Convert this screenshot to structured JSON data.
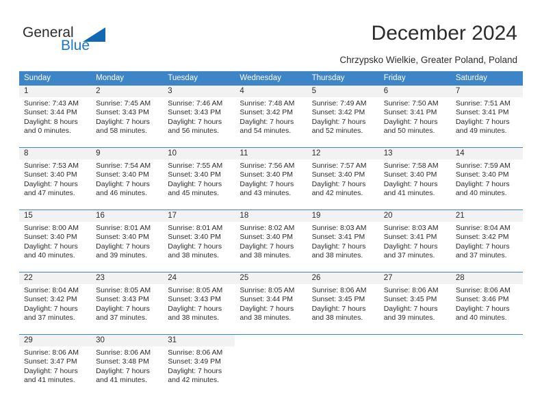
{
  "brand": {
    "word1": "General",
    "word2": "Blue",
    "logo_icon": "triangle-logo-icon",
    "blue": "#1878c8",
    "triangle_color": "#1268b3"
  },
  "header": {
    "month_title": "December 2024",
    "location": "Chrzypsko Wielkie, Greater Poland, Poland"
  },
  "calendar": {
    "header_bg": "#3d85c6",
    "day_num_bg": "#f2f2f2",
    "weekdays": [
      "Sunday",
      "Monday",
      "Tuesday",
      "Wednesday",
      "Thursday",
      "Friday",
      "Saturday"
    ],
    "weeks": [
      [
        {
          "day": "1",
          "sunrise": "Sunrise: 7:43 AM",
          "sunset": "Sunset: 3:44 PM",
          "daylight1": "Daylight: 8 hours",
          "daylight2": "and 0 minutes."
        },
        {
          "day": "2",
          "sunrise": "Sunrise: 7:45 AM",
          "sunset": "Sunset: 3:43 PM",
          "daylight1": "Daylight: 7 hours",
          "daylight2": "and 58 minutes."
        },
        {
          "day": "3",
          "sunrise": "Sunrise: 7:46 AM",
          "sunset": "Sunset: 3:43 PM",
          "daylight1": "Daylight: 7 hours",
          "daylight2": "and 56 minutes."
        },
        {
          "day": "4",
          "sunrise": "Sunrise: 7:48 AM",
          "sunset": "Sunset: 3:42 PM",
          "daylight1": "Daylight: 7 hours",
          "daylight2": "and 54 minutes."
        },
        {
          "day": "5",
          "sunrise": "Sunrise: 7:49 AM",
          "sunset": "Sunset: 3:42 PM",
          "daylight1": "Daylight: 7 hours",
          "daylight2": "and 52 minutes."
        },
        {
          "day": "6",
          "sunrise": "Sunrise: 7:50 AM",
          "sunset": "Sunset: 3:41 PM",
          "daylight1": "Daylight: 7 hours",
          "daylight2": "and 50 minutes."
        },
        {
          "day": "7",
          "sunrise": "Sunrise: 7:51 AM",
          "sunset": "Sunset: 3:41 PM",
          "daylight1": "Daylight: 7 hours",
          "daylight2": "and 49 minutes."
        }
      ],
      [
        {
          "day": "8",
          "sunrise": "Sunrise: 7:53 AM",
          "sunset": "Sunset: 3:40 PM",
          "daylight1": "Daylight: 7 hours",
          "daylight2": "and 47 minutes."
        },
        {
          "day": "9",
          "sunrise": "Sunrise: 7:54 AM",
          "sunset": "Sunset: 3:40 PM",
          "daylight1": "Daylight: 7 hours",
          "daylight2": "and 46 minutes."
        },
        {
          "day": "10",
          "sunrise": "Sunrise: 7:55 AM",
          "sunset": "Sunset: 3:40 PM",
          "daylight1": "Daylight: 7 hours",
          "daylight2": "and 45 minutes."
        },
        {
          "day": "11",
          "sunrise": "Sunrise: 7:56 AM",
          "sunset": "Sunset: 3:40 PM",
          "daylight1": "Daylight: 7 hours",
          "daylight2": "and 43 minutes."
        },
        {
          "day": "12",
          "sunrise": "Sunrise: 7:57 AM",
          "sunset": "Sunset: 3:40 PM",
          "daylight1": "Daylight: 7 hours",
          "daylight2": "and 42 minutes."
        },
        {
          "day": "13",
          "sunrise": "Sunrise: 7:58 AM",
          "sunset": "Sunset: 3:40 PM",
          "daylight1": "Daylight: 7 hours",
          "daylight2": "and 41 minutes."
        },
        {
          "day": "14",
          "sunrise": "Sunrise: 7:59 AM",
          "sunset": "Sunset: 3:40 PM",
          "daylight1": "Daylight: 7 hours",
          "daylight2": "and 40 minutes."
        }
      ],
      [
        {
          "day": "15",
          "sunrise": "Sunrise: 8:00 AM",
          "sunset": "Sunset: 3:40 PM",
          "daylight1": "Daylight: 7 hours",
          "daylight2": "and 40 minutes."
        },
        {
          "day": "16",
          "sunrise": "Sunrise: 8:01 AM",
          "sunset": "Sunset: 3:40 PM",
          "daylight1": "Daylight: 7 hours",
          "daylight2": "and 39 minutes."
        },
        {
          "day": "17",
          "sunrise": "Sunrise: 8:01 AM",
          "sunset": "Sunset: 3:40 PM",
          "daylight1": "Daylight: 7 hours",
          "daylight2": "and 38 minutes."
        },
        {
          "day": "18",
          "sunrise": "Sunrise: 8:02 AM",
          "sunset": "Sunset: 3:40 PM",
          "daylight1": "Daylight: 7 hours",
          "daylight2": "and 38 minutes."
        },
        {
          "day": "19",
          "sunrise": "Sunrise: 8:03 AM",
          "sunset": "Sunset: 3:41 PM",
          "daylight1": "Daylight: 7 hours",
          "daylight2": "and 38 minutes."
        },
        {
          "day": "20",
          "sunrise": "Sunrise: 8:03 AM",
          "sunset": "Sunset: 3:41 PM",
          "daylight1": "Daylight: 7 hours",
          "daylight2": "and 37 minutes."
        },
        {
          "day": "21",
          "sunrise": "Sunrise: 8:04 AM",
          "sunset": "Sunset: 3:42 PM",
          "daylight1": "Daylight: 7 hours",
          "daylight2": "and 37 minutes."
        }
      ],
      [
        {
          "day": "22",
          "sunrise": "Sunrise: 8:04 AM",
          "sunset": "Sunset: 3:42 PM",
          "daylight1": "Daylight: 7 hours",
          "daylight2": "and 37 minutes."
        },
        {
          "day": "23",
          "sunrise": "Sunrise: 8:05 AM",
          "sunset": "Sunset: 3:43 PM",
          "daylight1": "Daylight: 7 hours",
          "daylight2": "and 37 minutes."
        },
        {
          "day": "24",
          "sunrise": "Sunrise: 8:05 AM",
          "sunset": "Sunset: 3:43 PM",
          "daylight1": "Daylight: 7 hours",
          "daylight2": "and 38 minutes."
        },
        {
          "day": "25",
          "sunrise": "Sunrise: 8:05 AM",
          "sunset": "Sunset: 3:44 PM",
          "daylight1": "Daylight: 7 hours",
          "daylight2": "and 38 minutes."
        },
        {
          "day": "26",
          "sunrise": "Sunrise: 8:06 AM",
          "sunset": "Sunset: 3:45 PM",
          "daylight1": "Daylight: 7 hours",
          "daylight2": "and 38 minutes."
        },
        {
          "day": "27",
          "sunrise": "Sunrise: 8:06 AM",
          "sunset": "Sunset: 3:45 PM",
          "daylight1": "Daylight: 7 hours",
          "daylight2": "and 39 minutes."
        },
        {
          "day": "28",
          "sunrise": "Sunrise: 8:06 AM",
          "sunset": "Sunset: 3:46 PM",
          "daylight1": "Daylight: 7 hours",
          "daylight2": "and 40 minutes."
        }
      ],
      [
        {
          "day": "29",
          "sunrise": "Sunrise: 8:06 AM",
          "sunset": "Sunset: 3:47 PM",
          "daylight1": "Daylight: 7 hours",
          "daylight2": "and 41 minutes."
        },
        {
          "day": "30",
          "sunrise": "Sunrise: 8:06 AM",
          "sunset": "Sunset: 3:48 PM",
          "daylight1": "Daylight: 7 hours",
          "daylight2": "and 41 minutes."
        },
        {
          "day": "31",
          "sunrise": "Sunrise: 8:06 AM",
          "sunset": "Sunset: 3:49 PM",
          "daylight1": "Daylight: 7 hours",
          "daylight2": "and 42 minutes."
        },
        {
          "day": "",
          "sunrise": "",
          "sunset": "",
          "daylight1": "",
          "daylight2": ""
        },
        {
          "day": "",
          "sunrise": "",
          "sunset": "",
          "daylight1": "",
          "daylight2": ""
        },
        {
          "day": "",
          "sunrise": "",
          "sunset": "",
          "daylight1": "",
          "daylight2": ""
        },
        {
          "day": "",
          "sunrise": "",
          "sunset": "",
          "daylight1": "",
          "daylight2": ""
        }
      ]
    ]
  }
}
